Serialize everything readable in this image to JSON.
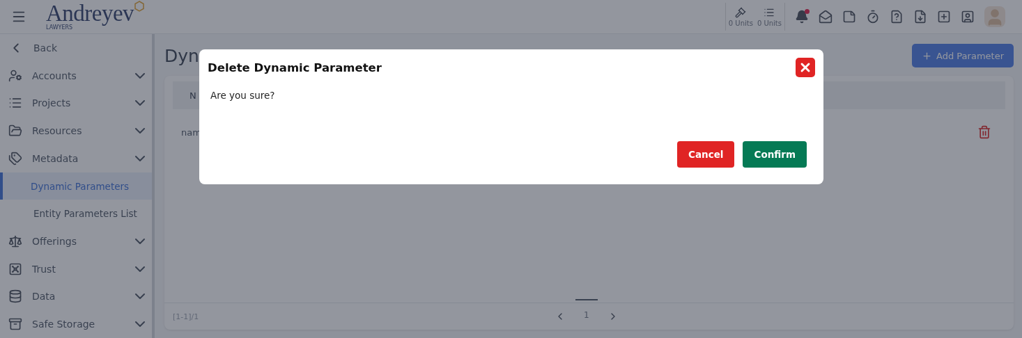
{
  "header": {
    "logo": {
      "name": "Andreyev",
      "tagline": "LAWYERS"
    },
    "counters": [
      {
        "label": "0 Units"
      },
      {
        "label": "0 Units"
      }
    ],
    "bell": {
      "has_unread": true
    }
  },
  "sidebar": {
    "back": "Back",
    "items": [
      {
        "label": "Accounts"
      },
      {
        "label": "Projects"
      },
      {
        "label": "Resources"
      },
      {
        "label": "Metadata",
        "children": [
          {
            "label": "Dynamic Parameters",
            "selected": true
          },
          {
            "label": "Entity Parameters List",
            "selected": false
          }
        ]
      },
      {
        "label": "Offerings"
      },
      {
        "label": "Trust"
      },
      {
        "label": "Data"
      },
      {
        "label": "Safe Storage"
      }
    ]
  },
  "page": {
    "title": "Dyn",
    "add_button": "Add Parameter",
    "table": {
      "columns": [
        "N"
      ],
      "rows": [
        [
          "nam"
        ]
      ]
    },
    "footer": {
      "range": "[1-1]/1",
      "pages": [
        {
          "label": "1",
          "selected": true
        }
      ]
    }
  },
  "dialog": {
    "title": "Delete Dynamic Parameter",
    "message": "Are you sure?",
    "buttons": [
      {
        "label": "Cancel",
        "kind": "cancel"
      },
      {
        "label": "Confirm",
        "kind": "confirm"
      }
    ]
  }
}
